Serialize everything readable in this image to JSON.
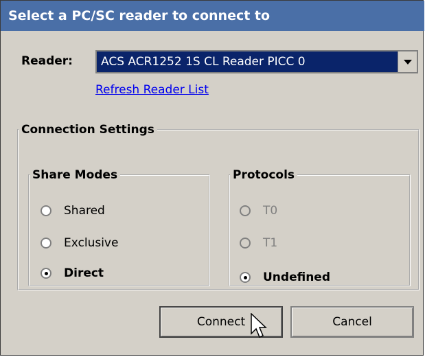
{
  "window": {
    "title": "Select a PC/SC reader to connect to"
  },
  "reader": {
    "label": "Reader:",
    "selected": "ACS ACR1252 1S CL Reader PICC 0",
    "refresh_link": "Refresh Reader List"
  },
  "connection": {
    "legend": "Connection Settings",
    "share_modes": {
      "legend": "Share Modes",
      "options": [
        "Shared",
        "Exclusive",
        "Direct"
      ],
      "selected": "Direct"
    },
    "protocols": {
      "legend": "Protocols",
      "options": [
        "T0",
        "T1",
        "Undefined"
      ],
      "selected": "Undefined"
    }
  },
  "buttons": {
    "connect": "Connect",
    "cancel": "Cancel"
  },
  "icons": {
    "dropdown": "chevron-down-icon",
    "cursor": "mouse-pointer-icon"
  },
  "colors": {
    "titlebar": "#4a6fa7",
    "selection": "#0a246a",
    "link": "#0000ee",
    "face": "#d4d0c8"
  }
}
